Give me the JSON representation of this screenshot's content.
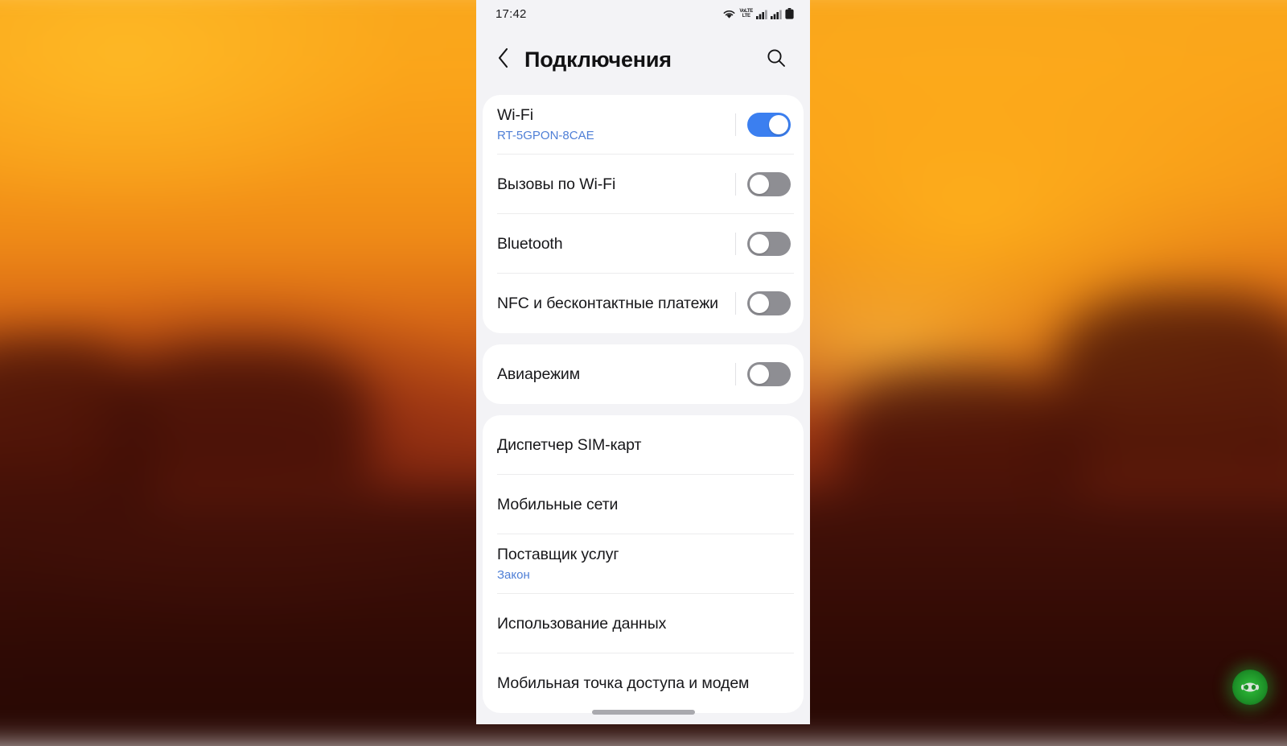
{
  "statusbar": {
    "clock": "17:42",
    "icons": [
      "wifi-icon",
      "volte-icon",
      "signal-sim1-icon",
      "signal-sim2-icon",
      "battery-icon"
    ],
    "volte_label": "VoLTE"
  },
  "appbar": {
    "back_icon": "chevron-left-icon",
    "title": "Подключения",
    "search_icon": "search-icon"
  },
  "colors": {
    "accent_toggle_on": "#3b7ff0",
    "toggle_off": "#8e8e93",
    "subtitle_blue": "#4f7fd6",
    "panel_bg": "#f3f3f6",
    "card_bg": "#ffffff"
  },
  "groups": [
    {
      "name": "connectivity-group",
      "rows": [
        {
          "label": "Wi-Fi",
          "sub": "RT-5GPON-8CAE",
          "control": "toggle",
          "state": "on",
          "name": "wifi"
        },
        {
          "label": "Вызовы по Wi-Fi",
          "sub": "",
          "control": "toggle",
          "state": "off",
          "name": "wifi-calling"
        },
        {
          "label": "Bluetooth",
          "sub": "",
          "control": "toggle",
          "state": "off",
          "name": "bluetooth"
        },
        {
          "label": "NFC и бесконтактные платежи",
          "sub": "",
          "control": "toggle",
          "state": "off",
          "name": "nfc"
        }
      ]
    },
    {
      "name": "airplane-group",
      "rows": [
        {
          "label": "Авиарежим",
          "sub": "",
          "control": "toggle",
          "state": "off",
          "name": "airplane-mode"
        }
      ]
    },
    {
      "name": "mobile-group",
      "rows": [
        {
          "label": "Диспетчер SIM-карт",
          "sub": "",
          "control": "none",
          "state": "",
          "name": "sim-manager"
        },
        {
          "label": "Мобильные сети",
          "sub": "",
          "control": "none",
          "state": "",
          "name": "mobile-networks"
        },
        {
          "label": "Поставщик услуг",
          "sub": "Закон",
          "control": "none",
          "state": "",
          "name": "service-provider"
        },
        {
          "label": "Использование данных",
          "sub": "",
          "control": "none",
          "state": "",
          "name": "data-usage"
        },
        {
          "label": "Мобильная точка доступа и модем",
          "sub": "",
          "control": "none",
          "state": "",
          "name": "hotspot-tethering"
        }
      ]
    }
  ],
  "home_indicator": "home-gesture-bar",
  "watermark": "infinity-badge-icon"
}
